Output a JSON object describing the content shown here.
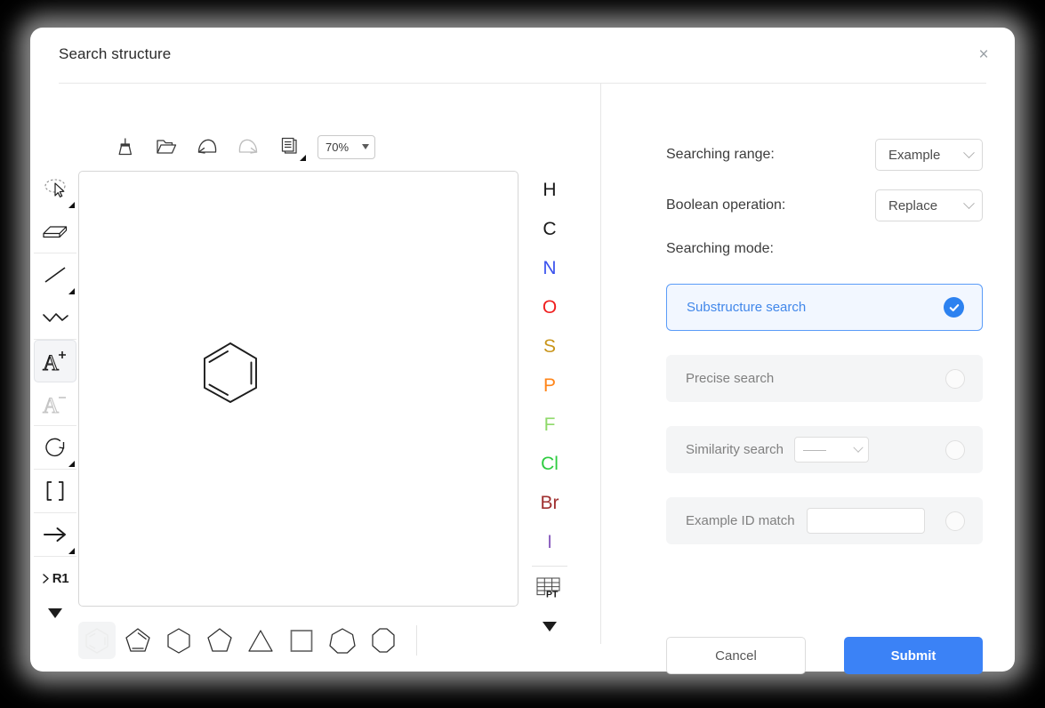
{
  "dialog": {
    "title": "Search structure",
    "close_label": "×"
  },
  "editor": {
    "toolbar": {
      "items": [
        {
          "name": "clear-canvas",
          "label": "Clear"
        },
        {
          "name": "open-file",
          "label": "Open"
        },
        {
          "name": "undo",
          "label": "Undo"
        },
        {
          "name": "redo",
          "label": "Redo"
        },
        {
          "name": "copy",
          "label": "Copy"
        }
      ],
      "zoom_value": "70%"
    },
    "tools": [
      {
        "name": "select-lasso",
        "label": "Select"
      },
      {
        "name": "eraser",
        "label": "Erase"
      },
      {
        "name": "single-bond",
        "label": "Bond"
      },
      {
        "name": "chain",
        "label": "Chain"
      },
      {
        "name": "charge-plus",
        "label": "A+"
      },
      {
        "name": "charge-minus",
        "label": "A-"
      },
      {
        "name": "rotate",
        "label": "Rotate"
      },
      {
        "name": "brackets",
        "label": "[ ]"
      },
      {
        "name": "reaction-arrow",
        "label": "Arrow"
      },
      {
        "name": "r-group",
        "label": "R1"
      }
    ],
    "tools_more_label": "More tools",
    "elements": [
      {
        "symbol": "H",
        "color": "#1a1a1a"
      },
      {
        "symbol": "C",
        "color": "#1a1a1a"
      },
      {
        "symbol": "N",
        "color": "#3b53ee"
      },
      {
        "symbol": "O",
        "color": "#f01f1f"
      },
      {
        "symbol": "S",
        "color": "#c9951b"
      },
      {
        "symbol": "P",
        "color": "#ff8519"
      },
      {
        "symbol": "F",
        "color": "#8fd96a"
      },
      {
        "symbol": "Cl",
        "color": "#2ecc40"
      },
      {
        "symbol": "Br",
        "color": "#a03030"
      },
      {
        "symbol": "I",
        "color": "#8b5fbf"
      }
    ],
    "periodic_table_label": "PT",
    "elements_more_label": "More elements",
    "shapes": [
      {
        "name": "benzene-ring",
        "sides": 6,
        "aromatic": true,
        "selected": true
      },
      {
        "name": "cyclopentadiene-ring",
        "sides": 5,
        "aromatic": true,
        "selected": false
      },
      {
        "name": "cyclohexane-ring",
        "sides": 6,
        "aromatic": false,
        "selected": false
      },
      {
        "name": "cyclopentane-ring",
        "sides": 5,
        "aromatic": false,
        "selected": false
      },
      {
        "name": "cyclopropane-ring",
        "sides": 3,
        "aromatic": false,
        "selected": false
      },
      {
        "name": "cyclobutane-ring",
        "sides": 4,
        "aromatic": false,
        "selected": false
      },
      {
        "name": "cycloheptane-ring",
        "sides": 7,
        "aromatic": false,
        "selected": false
      },
      {
        "name": "cyclooctane-ring",
        "sides": 8,
        "aromatic": false,
        "selected": false
      }
    ],
    "canvas": {
      "structure": "benzene"
    }
  },
  "panel": {
    "searching_range": {
      "label": "Searching range:",
      "value": "Example"
    },
    "boolean_operation": {
      "label": "Boolean operation:",
      "value": "Replace"
    },
    "searching_mode": {
      "label": "Searching mode:",
      "modes": [
        {
          "name": "substructure-search",
          "label": "Substructure search",
          "selected": true
        },
        {
          "name": "precise-search",
          "label": "Precise search",
          "selected": false
        },
        {
          "name": "similarity-search",
          "label": "Similarity search",
          "selected": false,
          "select_value": "——"
        },
        {
          "name": "example-id-match",
          "label": "Example ID match",
          "selected": false,
          "input_value": "",
          "input_placeholder": ""
        }
      ]
    }
  },
  "footer": {
    "cancel_label": "Cancel",
    "submit_label": "Submit"
  },
  "colors": {
    "accent": "#3b82f6",
    "selected_card_bg": "#f2f7ff",
    "selected_card_border": "#5a9cf8",
    "plain_card_bg": "#f4f5f6",
    "dialog_bg": "#ffffff",
    "page_bg": "#000000"
  }
}
